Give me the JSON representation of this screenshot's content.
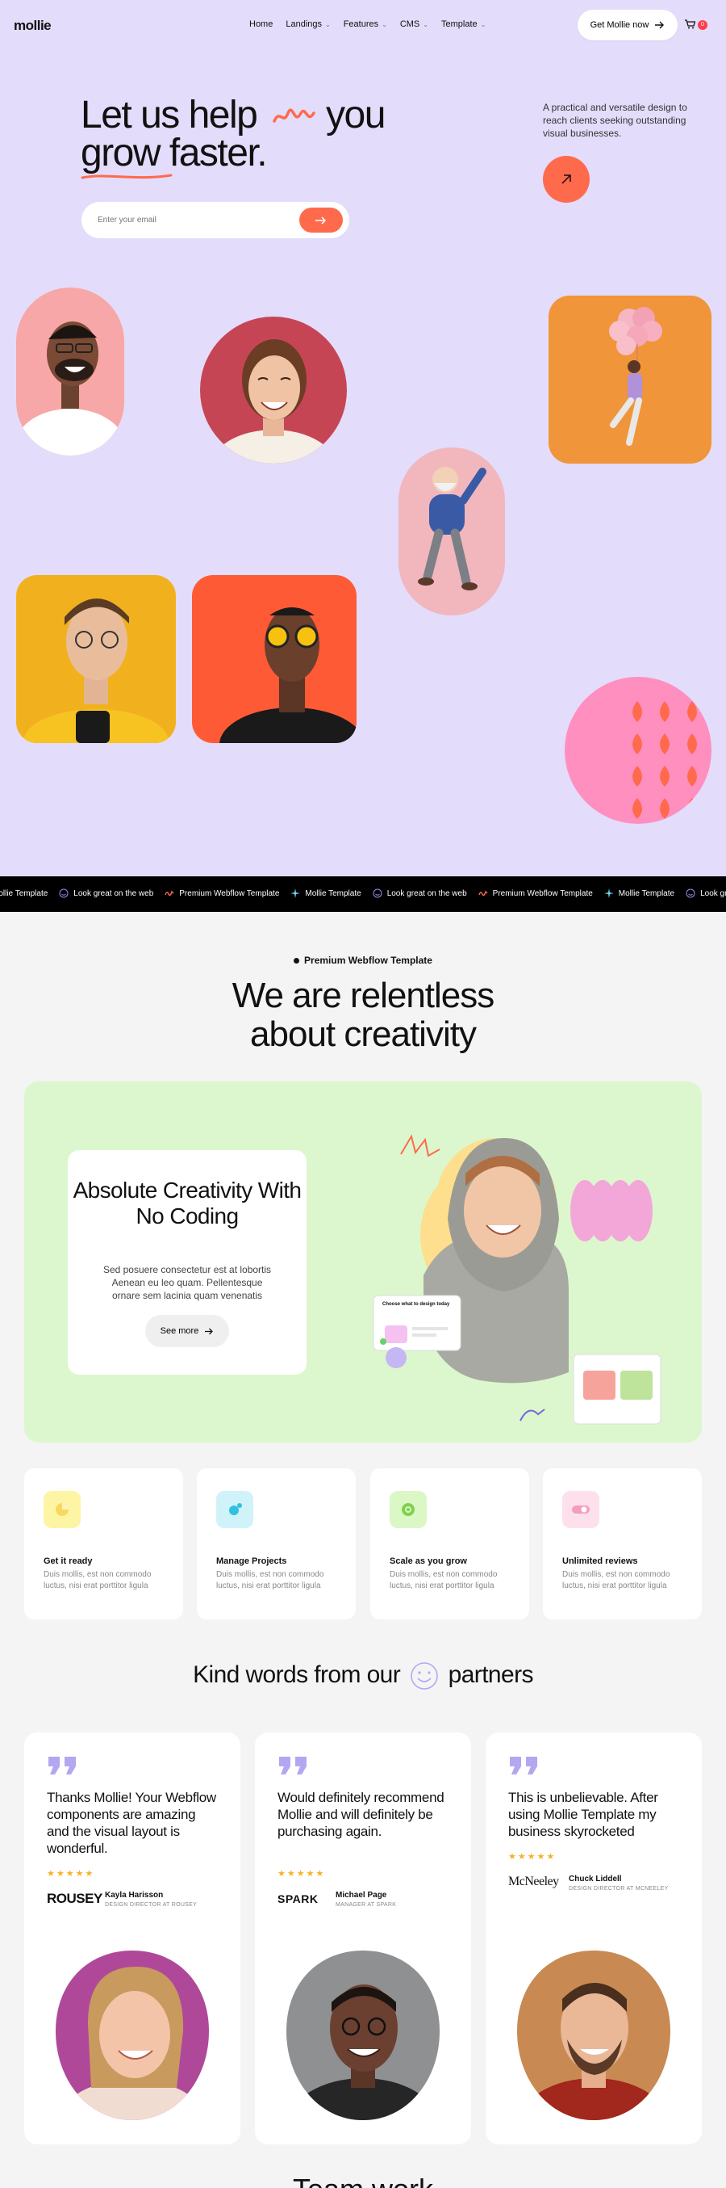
{
  "nav": {
    "logo": "mollie",
    "items": [
      {
        "label": "Home",
        "has_dropdown": false
      },
      {
        "label": "Landings",
        "has_dropdown": true
      },
      {
        "label": "Features",
        "has_dropdown": true
      },
      {
        "label": "CMS",
        "has_dropdown": true
      },
      {
        "label": "Template",
        "has_dropdown": true
      }
    ],
    "cta_label": "Get Mollie now",
    "cart_count": "0"
  },
  "hero": {
    "line1": "Let us help",
    "line1_after": "you",
    "line2": "grow faster.",
    "description": "A practical and versatile design to reach clients seeking outstanding visual businesses.",
    "email_placeholder": "Enter your email",
    "accent": "#ff6a4d",
    "background": "#e3dcfa"
  },
  "marquee": {
    "items": [
      {
        "label": "Mollie Template",
        "icon": "star-burst-icon"
      },
      {
        "label": "Look great on the web",
        "icon": "smiley-icon"
      },
      {
        "label": "Premium Webflow Template",
        "icon": "squiggle-icon"
      },
      {
        "label": "Mollie Template",
        "icon": "star-burst-icon"
      },
      {
        "label": "Look great on the web",
        "icon": "smiley-icon"
      },
      {
        "label": "Premium Webflow Template",
        "icon": "squiggle-icon"
      },
      {
        "label": "Mollie Template",
        "icon": "star-burst-icon"
      },
      {
        "label": "Look great on the web",
        "icon": "smiley-icon"
      }
    ]
  },
  "creativity": {
    "eyebrow": "Premium Webflow Template",
    "title_line1": "We are relentless",
    "title_line2": "about creativity",
    "card_title": "Absolute Creativity With No Coding",
    "card_text": "Sed posuere consectetur est at lobortis Aenean eu leo quam. Pellentesque ornare sem lacinia quam venenatis",
    "card_button": "See more",
    "ui_mock_title": "Choose what to design today"
  },
  "features": [
    {
      "title": "Get it ready",
      "text": "Duis mollis, est non commodo luctus, nisi erat porttitor ligula",
      "icon": "pie-chart-icon",
      "color": "#fdf5a3"
    },
    {
      "title": "Manage Projects",
      "text": "Duis mollis, est non commodo luctus, nisi erat porttitor ligula",
      "icon": "dots-icon",
      "color": "#cff3f9"
    },
    {
      "title": "Scale as you grow",
      "text": "Duis mollis, est non commodo luctus, nisi erat porttitor ligula",
      "icon": "target-icon",
      "color": "#dcf7c6"
    },
    {
      "title": "Unlimited reviews",
      "text": "Duis mollis, est non commodo luctus, nisi erat porttitor ligula",
      "icon": "toggle-icon",
      "color": "#fde0ec"
    }
  ],
  "testimonials": {
    "title_before": "Kind words from our",
    "title_after": "partners",
    "items": [
      {
        "quote": "Thanks Mollie! Your Webflow components are amazing and the visual layout is wonderful.",
        "stars": "★★★★★",
        "logo": "ROUSEY",
        "name": "Kayla Harisson",
        "role": "DESIGN DIRECTOR AT ROUSEY"
      },
      {
        "quote": "Would definitely recommend Mollie and will definitely be purchasing again.",
        "stars": "★★★★★",
        "logo": "SPARK",
        "name": "Michael Page",
        "role": "MANAGER AT SPARK"
      },
      {
        "quote": "This is unbelievable. After using Mollie Template my business skyrocketed",
        "stars": "★★★★★",
        "logo": "McNeeley",
        "name": "Chuck Liddell",
        "role": "DESIGN DIRECTOR AT MCNEELEY"
      }
    ]
  },
  "next_section_title": "Team work"
}
